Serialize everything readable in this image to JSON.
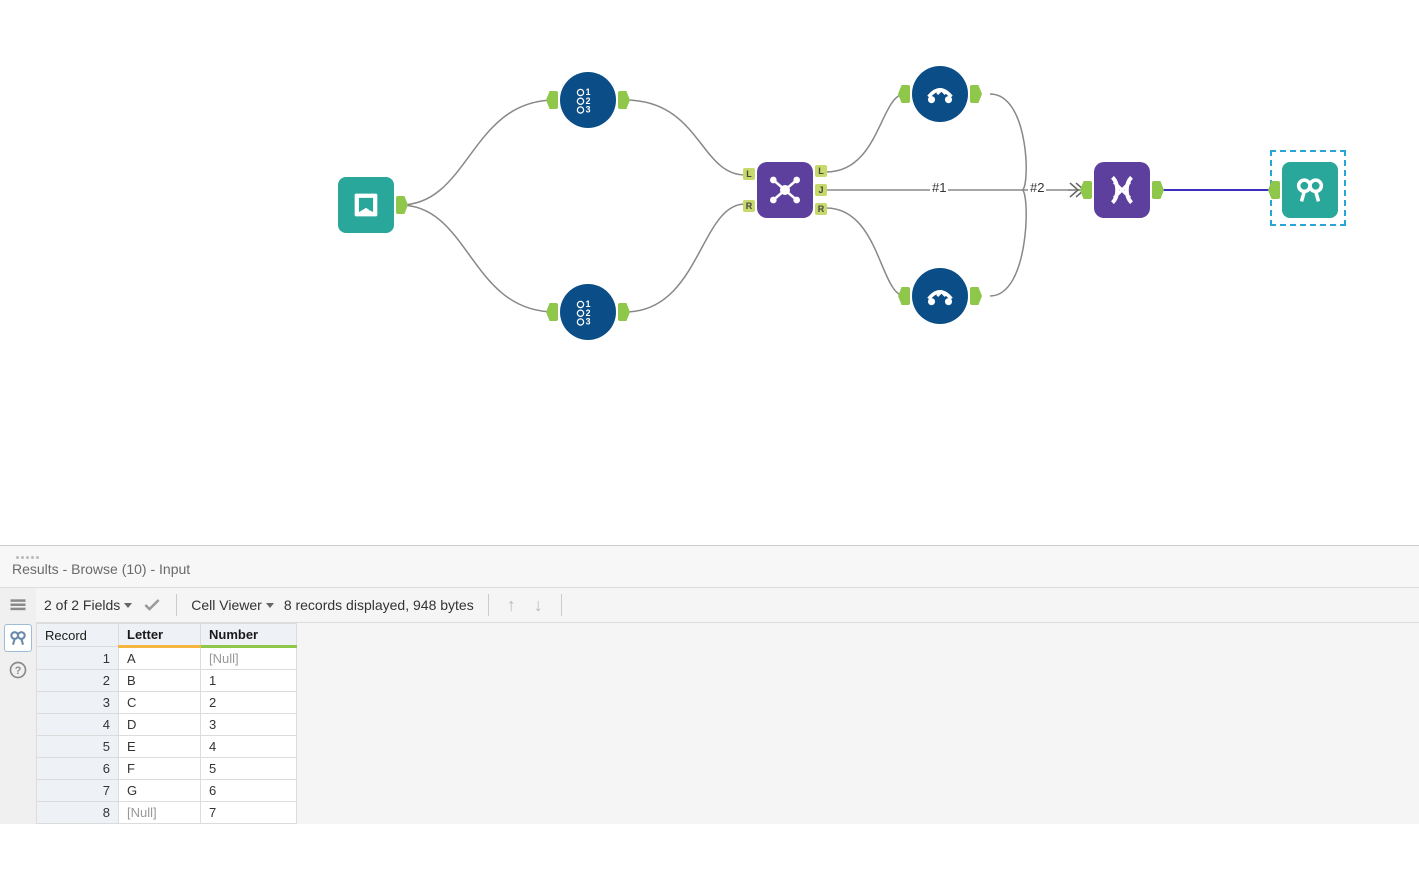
{
  "results": {
    "title": "Results - Browse (10) - Input",
    "fields_summary": "2 of 2 Fields",
    "cell_viewer_label": "Cell Viewer",
    "records_summary": "8 records displayed, 948 bytes",
    "columns": {
      "record": "Record",
      "letter": "Letter",
      "number": "Number"
    },
    "null_text": "[Null]",
    "rows": [
      {
        "record": "1",
        "letter": "A",
        "number": "[Null]",
        "number_null": true
      },
      {
        "record": "2",
        "letter": "B",
        "number": "1"
      },
      {
        "record": "3",
        "letter": "C",
        "number": "2"
      },
      {
        "record": "4",
        "letter": "D",
        "number": "3"
      },
      {
        "record": "5",
        "letter": "E",
        "number": "4"
      },
      {
        "record": "6",
        "letter": "F",
        "number": "5"
      },
      {
        "record": "7",
        "letter": "G",
        "number": "6"
      },
      {
        "record": "8",
        "letter": "[Null]",
        "letter_null": true,
        "number": "7"
      }
    ]
  },
  "workflow": {
    "wire_labels": {
      "w1": "#1",
      "w2": "#2"
    },
    "join_anchors": {
      "L": "L",
      "R": "R",
      "J": "J"
    },
    "tools": {
      "input": "text-input-tool",
      "recordid_top": "record-id-tool",
      "recordid_bottom": "record-id-tool",
      "join": "join-tool",
      "multirow_top": "multi-row-formula-tool",
      "multirow_bottom": "multi-row-formula-tool",
      "formula": "formula-tool",
      "browse": "browse-tool"
    }
  },
  "colors": {
    "teal": "#28a79a",
    "purple": "#5d3f9e",
    "blue": "#0b4d87",
    "green": "#8fc74a"
  }
}
